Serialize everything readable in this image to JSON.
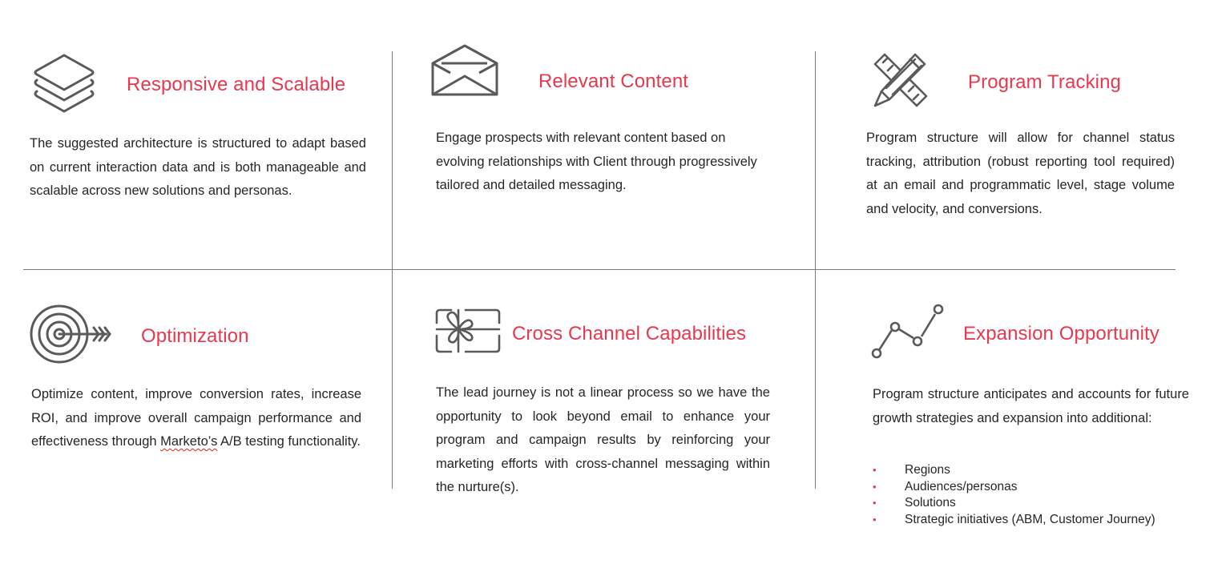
{
  "colors": {
    "accent": "#e8384f",
    "icon": "#5a5a5a",
    "divider": "#7a7a7a",
    "text": "#262626"
  },
  "cards": [
    {
      "icon": "stacked-layers-icon",
      "title": "Responsive and Scalable",
      "body": "The suggested architecture is structured to adapt based on current interaction data and is both manageable and scalable across new solutions and personas."
    },
    {
      "icon": "envelope-icon",
      "title": "Relevant Content",
      "body": "Engage prospects with relevant content based on evolving relationships with Client through progressively tailored and detailed messaging."
    },
    {
      "icon": "pencil-ruler-icon",
      "title": "Program Tracking",
      "body": "Program structure will allow for channel status tracking, attribution (robust reporting tool required) at an email and programmatic level, stage volume and velocity, and conversions."
    },
    {
      "icon": "target-arrow-icon",
      "title": "Optimization",
      "body_before": "Optimize content, improve conversion rates, increase ROI, and improve overall campaign performance and effectiveness through ",
      "body_flagged": "Marketo’s",
      "body_after": " A/B testing functionality."
    },
    {
      "icon": "gift-card-icon",
      "title": "Cross Channel Capabilities",
      "body": "The lead journey is not a linear process so we have the opportunity to look beyond email to enhance your program and campaign results by reinforcing your marketing efforts with cross-channel messaging within the nurture(s)."
    },
    {
      "icon": "line-graph-icon",
      "title": "Expansion Opportunity",
      "body": "Program structure anticipates and accounts for future growth strategies and expansion into additional:",
      "bullets": [
        "Regions",
        "Audiences/personas",
        "Solutions",
        "Strategic initiatives (ABM, Customer Journey)"
      ]
    }
  ]
}
